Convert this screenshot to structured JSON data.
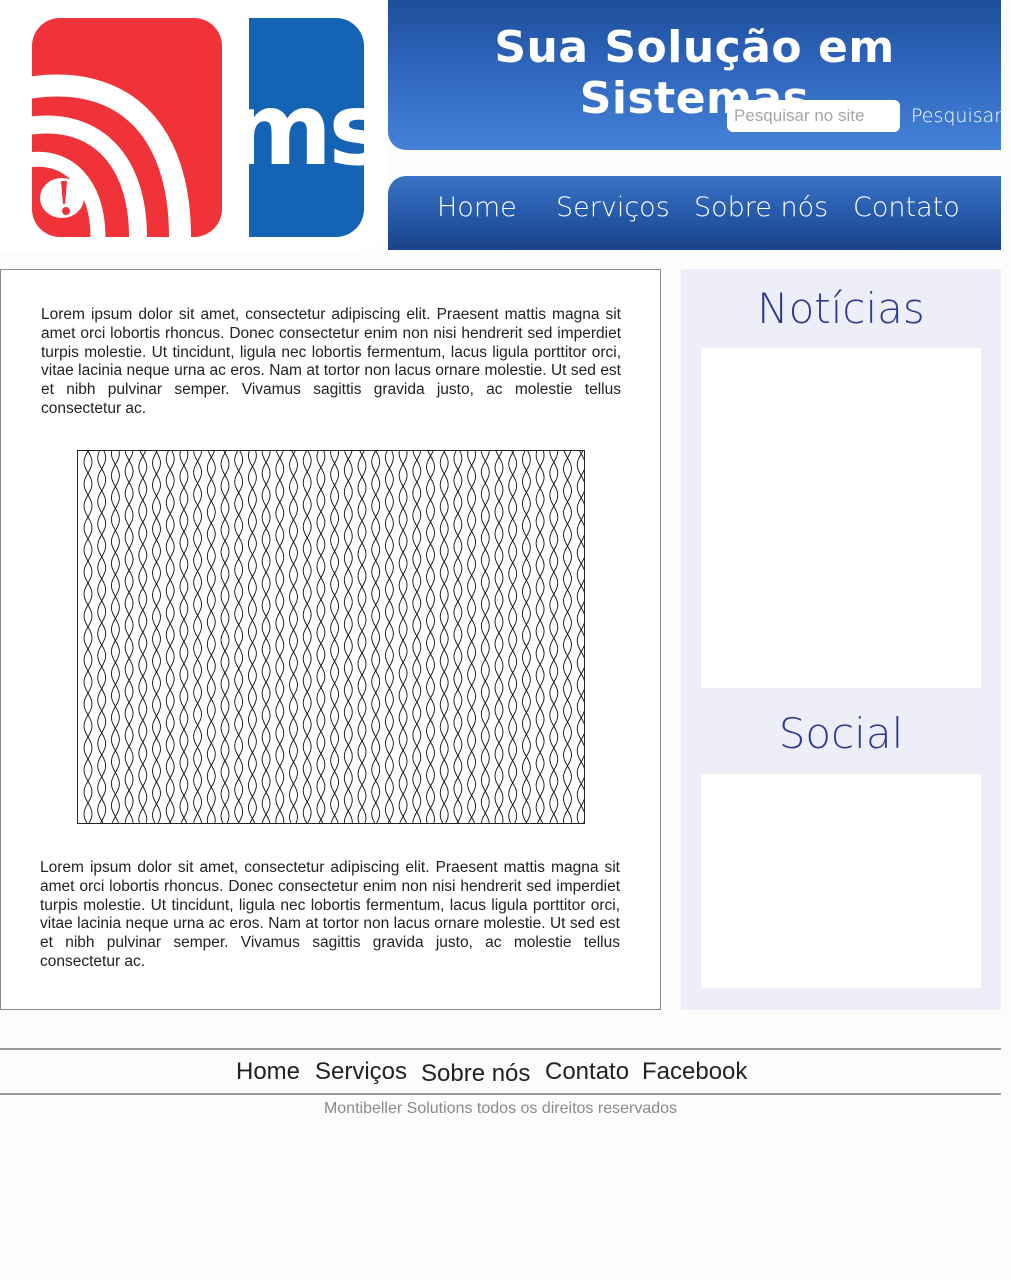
{
  "header": {
    "title": "Sua Solução em Sistemas",
    "search": {
      "placeholder": "Pesquisar no site",
      "button_label": "Pesquisar"
    },
    "nav": {
      "home": "Home",
      "services": "Serviços",
      "about": "Sobre nós",
      "contact": "Contato"
    },
    "logo_text": "ms"
  },
  "main": {
    "paragraph_1": "Lorem ipsum dolor sit amet, consectetur adipiscing elit. Praesent mattis magna sit amet orci lobortis rhoncus. Donec consectetur enim non nisi hendrerit sed imperdiet turpis molestie. Ut tincidunt, ligula nec lobortis fermentum, lacus ligula porttitor orci, vitae lacinia neque urna ac eros. Nam at tortor non lacus ornare molestie. Ut sed est et nibh pulvinar semper. Vivamus sagittis gravida justo, ac molestie tellus consectetur ac.",
    "paragraph_2": "Lorem ipsum dolor sit amet, consectetur adipiscing elit. Praesent mattis magna sit amet orci lobortis rhoncus. Donec consectetur enim non nisi hendrerit sed imperdiet turpis molestie. Ut tincidunt, ligula nec lobortis fermentum, lacus ligula porttitor orci, vitae lacinia neque urna ac eros. Nam at tortor non lacus ornare molestie. Ut sed est et nibh pulvinar semper. Vivamus sagittis gravida justo, ac molestie tellus consectetur ac."
  },
  "sidebar": {
    "news_title": "Notícias",
    "social_title": "Social"
  },
  "footer": {
    "links": {
      "home": "Home",
      "services": "Serviços",
      "about": "Sobre nós",
      "contact": "Contato",
      "facebook": "Facebook"
    },
    "copyright": "Montibeller Solutions todos os direitos reservados"
  },
  "colors": {
    "brand_blue": "#1463b4",
    "brand_red": "#ef3339",
    "sidebar_bg": "#edeef7",
    "sidebar_title": "#2e3b8c"
  }
}
